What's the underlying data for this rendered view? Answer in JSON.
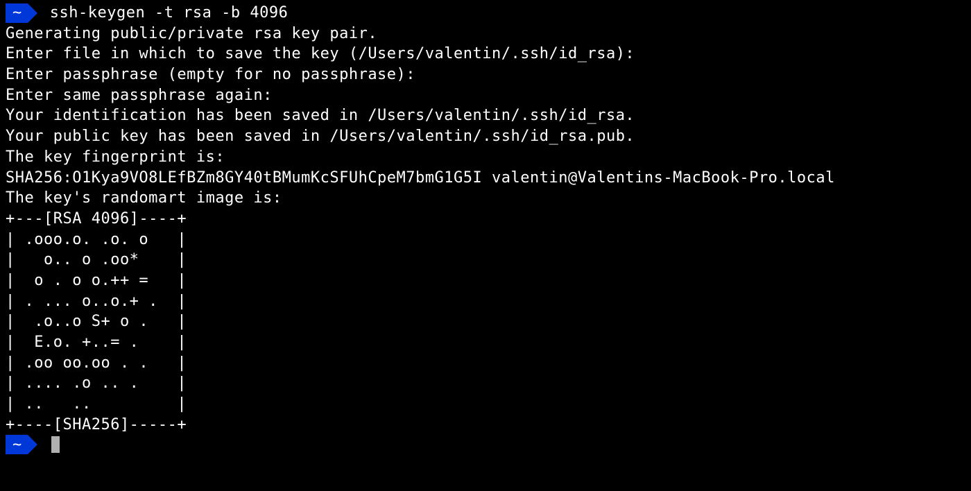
{
  "prompt1": {
    "path": "~",
    "command": "ssh-keygen -t rsa -b 4096"
  },
  "output": {
    "line1": "Generating public/private rsa key pair.",
    "line2": "Enter file in which to save the key (/Users/valentin/.ssh/id_rsa):",
    "line3": "Enter passphrase (empty for no passphrase):",
    "line4": "Enter same passphrase again:",
    "line5": "Your identification has been saved in /Users/valentin/.ssh/id_rsa.",
    "line6": "Your public key has been saved in /Users/valentin/.ssh/id_rsa.pub.",
    "line7": "The key fingerprint is:",
    "line8": "SHA256:O1Kya9VO8LEfBZm8GY40tBMumKcSFUhCpeM7bmG1G5I valentin@Valentins-MacBook-Pro.local",
    "line9": "The key's randomart image is:",
    "art1": "+---[RSA 4096]----+",
    "art2": "| .ooo.o. .o. o   |",
    "art3": "|   o.. o .oo*    |",
    "art4": "|  o . o o.++ =   |",
    "art5": "| . ... o..o.+ .  |",
    "art6": "|  .o..o S+ o .   |",
    "art7": "|  E.o. +..= .    |",
    "art8": "| .oo oo.oo . .   |",
    "art9": "| .... .o .. .    |",
    "art10": "| ..   ..         |",
    "art11": "+----[SHA256]-----+"
  },
  "prompt2": {
    "path": "~"
  }
}
